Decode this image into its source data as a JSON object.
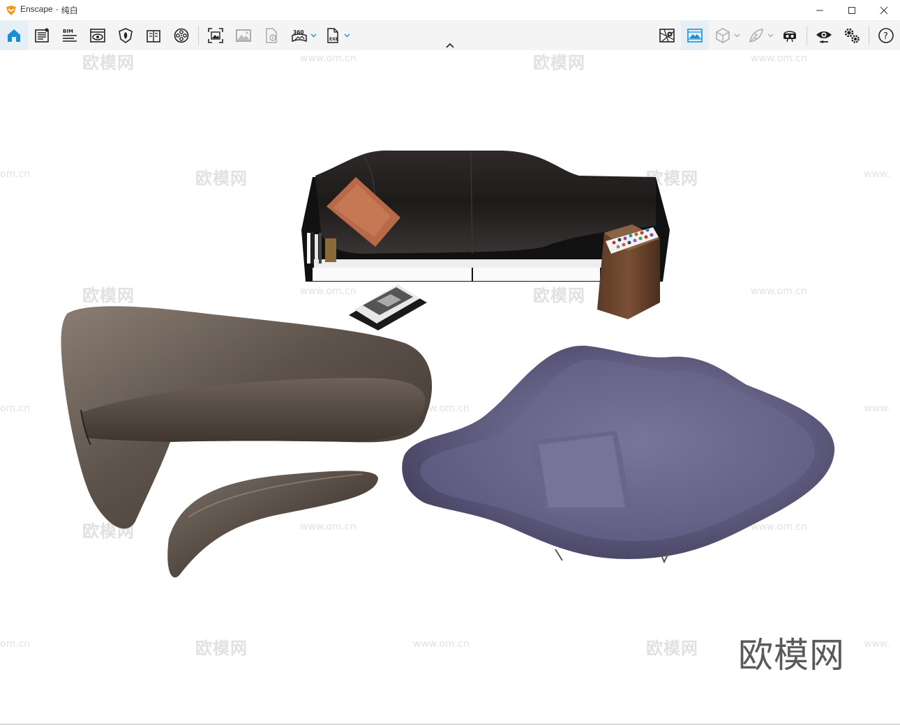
{
  "window": {
    "app_name": "Enscape",
    "separator": "-",
    "scene_name": "纯白",
    "controls": [
      "minimize-icon",
      "maximize-icon",
      "close-icon"
    ]
  },
  "toolbar": {
    "accent_color": "#1a8fd8",
    "left_tools": [
      {
        "name": "home-icon",
        "active": true
      },
      {
        "name": "checklist-icon"
      },
      {
        "name": "bim-icon",
        "label": "BIM"
      },
      {
        "name": "view-eye-icon"
      },
      {
        "name": "material-shield-icon"
      },
      {
        "name": "book-icon"
      },
      {
        "name": "film-reel-icon"
      }
    ],
    "export_tools": [
      {
        "name": "screenshot-icon"
      },
      {
        "name": "batch-image-icon"
      },
      {
        "name": "upload-file-icon"
      },
      {
        "name": "panorama-360-icon",
        "label": "360",
        "has_dropdown": true
      },
      {
        "name": "export-exe-icon",
        "label": "EXE",
        "has_dropdown": true
      }
    ],
    "right_tools": [
      {
        "name": "map-marker-icon"
      },
      {
        "name": "image-preset-icon",
        "active": true
      },
      {
        "name": "cube-icon",
        "has_dropdown": true
      },
      {
        "name": "leaf-asset-icon",
        "has_dropdown": true
      },
      {
        "name": "vr-headset-icon"
      },
      {
        "name": "visual-settings-eye-icon"
      },
      {
        "name": "settings-gears-icon"
      },
      {
        "name": "help-icon",
        "label": "?"
      }
    ]
  },
  "viewport": {
    "watermark_cn": "欧模网",
    "watermark_url": "www.om.cn",
    "watermark_url_partial": "om.cn",
    "watermark_url_cut": "www.",
    "brand_mark": "欧模网"
  }
}
